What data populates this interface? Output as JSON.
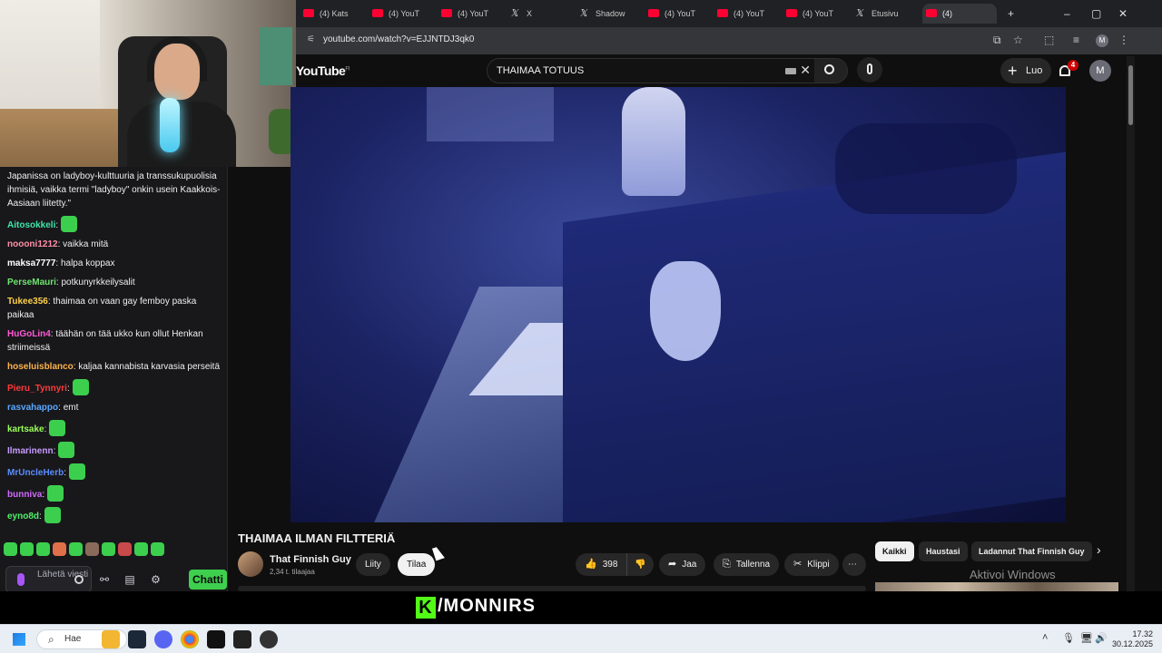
{
  "browser": {
    "tabs": [
      {
        "label": "(4) Kats",
        "icon": "youtube-icon"
      },
      {
        "label": "(4) YouT",
        "icon": "youtube-icon"
      },
      {
        "label": "(4) YouT",
        "icon": "youtube-icon"
      },
      {
        "label": "X",
        "icon": "x-icon"
      },
      {
        "label": "Shadow",
        "icon": "x-icon"
      },
      {
        "label": "(4) YouT",
        "icon": "youtube-icon"
      },
      {
        "label": "(4) YouT",
        "icon": "youtube-icon"
      },
      {
        "label": "(4) YouT",
        "icon": "youtube-icon"
      },
      {
        "label": "Etusivu",
        "icon": "x-icon"
      },
      {
        "label": "(4)",
        "icon": "youtube-icon"
      }
    ],
    "new_tab": "+",
    "url": "youtube.com/watch?v=EJJNTDJ3qk0"
  },
  "youtube": {
    "logo": "YouTube",
    "logo_region": "FI",
    "search_query": "THAIMAA TOTUUS",
    "create_label": "Luo",
    "notifications": "4",
    "avatar_letter": "M",
    "video_title": "THAIMAA ILMAN FILTTERIÄ",
    "channel_name": "That Finnish Guy",
    "subscribers": "2,34 t. tilaajaa",
    "join_label": "Liity",
    "subscribe_label": "Tilaa",
    "likes": "398",
    "share_label": "Jaa",
    "save_label": "Tallenna",
    "clip_label": "Klippi",
    "chips": [
      "Kaikki",
      "Haustasi",
      "Ladannut That Finnish Guy"
    ],
    "activate_windows": "Aktivoi Windows"
  },
  "chat": {
    "messages": [
      {
        "user": "",
        "color": "#ffffff",
        "text": "Japanissa on ladyboy-kulttuuria ja transsukupuolisia ihmisiä, vaikka termi \"ladyboy\" onkin usein Kaakkois-Aasiaan liitetty.\""
      },
      {
        "user": "Aitosokkeli",
        "color": "#3ee6a8",
        "text": ""
      },
      {
        "user": "noooni1212",
        "color": "#ff8fa8",
        "text": "vaikka mitä"
      },
      {
        "user": "maksa7777",
        "color": "#ffffff",
        "text": "halpa koppax"
      },
      {
        "user": "PerseMauri",
        "color": "#6fe46f",
        "text": "potkunyrkkeilysalit"
      },
      {
        "user": "Tukee356",
        "color": "#ffd24a",
        "text": "thaimaa on vaan gay femboy paska paikaa"
      },
      {
        "user": "HuGoLin4",
        "color": "#ff5ad6",
        "text": "täähän on tää ukko kun ollut Henkan striimeissä"
      },
      {
        "user": "hoseluisblanco",
        "color": "#ffb24a",
        "text": "kaljaa kannabista karvasia perseitä"
      },
      {
        "user": "Pieru_Tynnyri",
        "color": "#ff3b3b",
        "text": ""
      },
      {
        "user": "rasvahappo",
        "color": "#5aa8ff",
        "text": "emt"
      },
      {
        "user": "kartsake",
        "color": "#9cff5a",
        "text": ""
      },
      {
        "user": "Ilmarinenn",
        "color": "#c79bff",
        "text": ""
      },
      {
        "user": "MrUncleHerb",
        "color": "#5a8cff",
        "text": ""
      },
      {
        "user": "bunniva",
        "color": "#d06bff",
        "text": ""
      },
      {
        "user": "eyno8d",
        "color": "#4ff06a",
        "text": ""
      }
    ],
    "input_placeholder": "Lähetä viesti",
    "send_label": "Chatti"
  },
  "overlay": {
    "brand": "/MONNIRS",
    "brand_k": "K"
  },
  "taskbar": {
    "search": "Hae",
    "time": "17.32",
    "date": "30.12.2025"
  }
}
